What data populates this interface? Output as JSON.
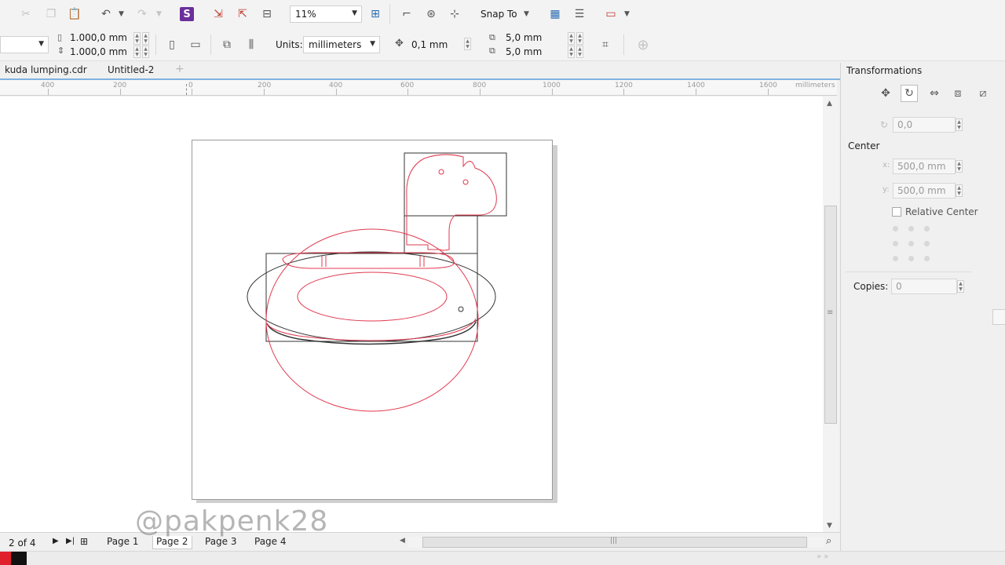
{
  "toolbar": {
    "zoom_value": "11%",
    "snap_label": "Snap To"
  },
  "property_bar": {
    "width_value": "1.000,0 mm",
    "height_value": "1.000,0 mm",
    "units_label": "Units:",
    "units_value": "millimeters",
    "nudge_value": "0,1 mm",
    "dup_x_value": "5,0 mm",
    "dup_y_value": "5,0 mm"
  },
  "document_tabs": [
    {
      "label": "kuda lumping.cdr"
    },
    {
      "label": "Untitled-2"
    }
  ],
  "ruler": {
    "labels": [
      "400",
      "200",
      "0",
      "200",
      "400",
      "600",
      "800",
      "1000",
      "1200",
      "1400",
      "1600"
    ],
    "unit": "millimeters"
  },
  "transformations": {
    "title": "Transformations",
    "angle_value": "0,0",
    "center_label": "Center",
    "x_label": "x:",
    "x_value": "500,0 mm",
    "y_label": "y:",
    "y_value": "500,0 mm",
    "relative_center_label": "Relative Center",
    "copies_label": "Copies:",
    "copies_value": "0"
  },
  "page_navigator": {
    "counter": "2 of 4",
    "pages": [
      "Page 1",
      "Page 2",
      "Page 3",
      "Page 4"
    ],
    "active_index": 1
  },
  "watermark": "@pakpenk28",
  "colors": {
    "outline_red": "#e0394f",
    "outline_dark": "#333333",
    "accent_blue": "#7fb3e0"
  }
}
